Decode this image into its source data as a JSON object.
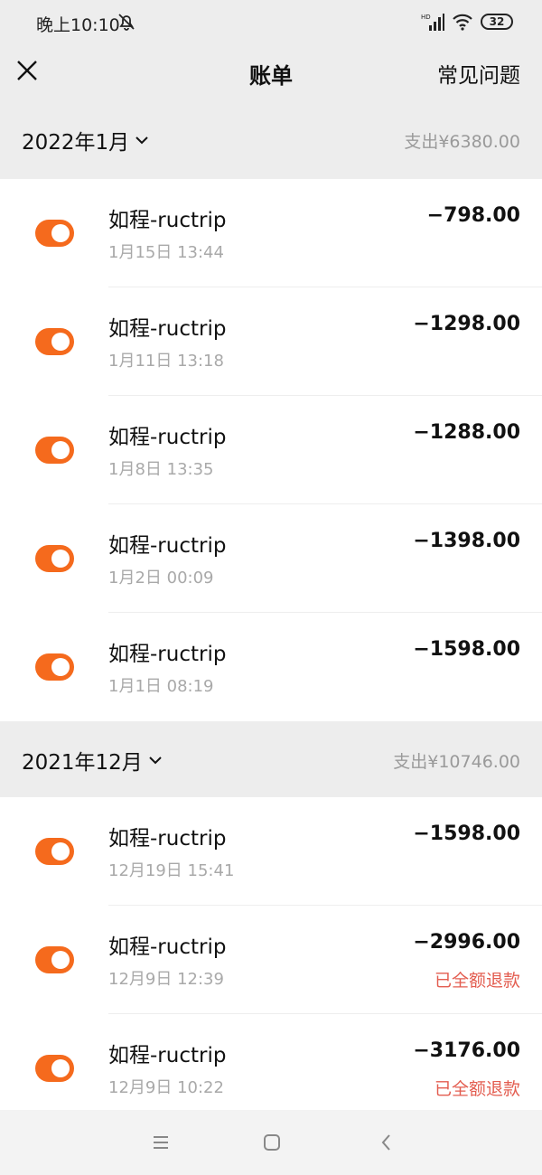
{
  "status_bar": {
    "time": "晚上10:10",
    "battery": "32",
    "hd": "HD"
  },
  "header": {
    "title": "账单",
    "faq": "常见问题"
  },
  "months": [
    {
      "label": "2022年1月",
      "total": "支出¥6380.00",
      "items": [
        {
          "merchant": "如程-ructrip",
          "time": "1月15日 13:44",
          "amount": "−798.00",
          "note": ""
        },
        {
          "merchant": "如程-ructrip",
          "time": "1月11日 13:18",
          "amount": "−1298.00",
          "note": ""
        },
        {
          "merchant": "如程-ructrip",
          "time": "1月8日 13:35",
          "amount": "−1288.00",
          "note": ""
        },
        {
          "merchant": "如程-ructrip",
          "time": "1月2日 00:09",
          "amount": "−1398.00",
          "note": ""
        },
        {
          "merchant": "如程-ructrip",
          "time": "1月1日 08:19",
          "amount": "−1598.00",
          "note": ""
        }
      ]
    },
    {
      "label": "2021年12月",
      "total": "支出¥10746.00",
      "items": [
        {
          "merchant": "如程-ructrip",
          "time": "12月19日 15:41",
          "amount": "−1598.00",
          "note": ""
        },
        {
          "merchant": "如程-ructrip",
          "time": "12月9日 12:39",
          "amount": "−2996.00",
          "note": "已全额退款"
        },
        {
          "merchant": "如程-ructrip",
          "time": "12月9日 10:22",
          "amount": "−3176.00",
          "note": "已全额退款"
        }
      ]
    }
  ],
  "colors": {
    "accent": "#f56a1d",
    "refund": "#e35d50",
    "muted": "#a9a9a9",
    "background": "#ededed"
  },
  "icons": [
    "close-icon",
    "chevron-down-icon",
    "merchant-toggle-icon",
    "menu-icon",
    "home-icon",
    "back-icon",
    "mute-icon",
    "signal-icon",
    "wifi-icon",
    "battery-icon"
  ]
}
